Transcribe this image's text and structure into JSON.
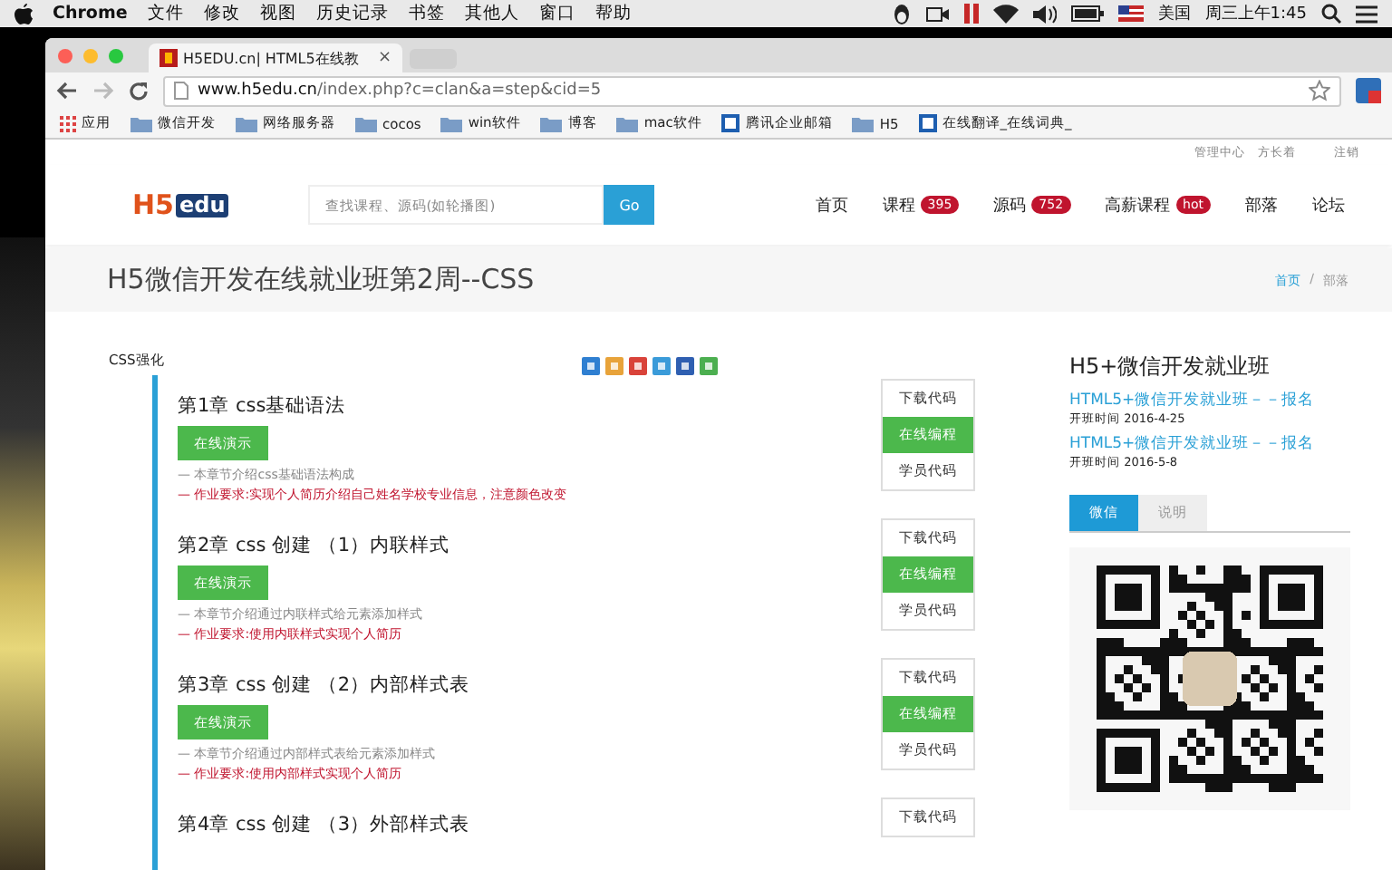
{
  "menu_bar": {
    "app": "Chrome",
    "menus": [
      "文件",
      "修改",
      "视图",
      "历史记录",
      "书签",
      "其他人",
      "窗口",
      "帮助"
    ],
    "input_source": "美国",
    "clock": "周三上午1:45"
  },
  "browser": {
    "tab": {
      "title": "H5EDU.cn| HTML5在线教",
      "close": "×"
    },
    "url": {
      "host": "www.h5edu.cn",
      "path": "/index.php?c=clan&a=step&cid=5"
    },
    "bookmarks": [
      {
        "label": "应用",
        "kind": "apps"
      },
      {
        "label": "微信开发",
        "kind": "folder"
      },
      {
        "label": "网络服务器",
        "kind": "folder"
      },
      {
        "label": "cocos",
        "kind": "folder"
      },
      {
        "label": "win软件",
        "kind": "folder"
      },
      {
        "label": "博客",
        "kind": "folder"
      },
      {
        "label": "mac软件",
        "kind": "folder"
      },
      {
        "label": "腾讯企业邮箱",
        "kind": "page"
      },
      {
        "label": "H5",
        "kind": "folder"
      },
      {
        "label": "在线翻译_在线词典_",
        "kind": "page"
      }
    ]
  },
  "page": {
    "top_links": [
      "管理中心",
      "方长着",
      "注销"
    ],
    "logo": {
      "h5": "H5",
      "edu": "edu"
    },
    "search": {
      "placeholder": "查找课程、源码(如轮播图)",
      "button": "Go"
    },
    "nav": [
      {
        "label": "首页"
      },
      {
        "label": "课程",
        "badge": "395"
      },
      {
        "label": "源码",
        "badge": "752"
      },
      {
        "label": "高薪课程",
        "badge": "hot"
      },
      {
        "label": "部落"
      },
      {
        "label": "论坛"
      }
    ],
    "title": "H5微信开发在线就业班第2周--CSS",
    "breadcrumb": {
      "items": [
        "首页",
        "部落"
      ],
      "separator": "/"
    },
    "section_label": "CSS强化",
    "chapters": [
      {
        "title": "第1章 css基础语法",
        "demo": "在线演示",
        "desc": "— 本章节介绍css基础语法构成",
        "task": "— 作业要求:实现个人简历介绍自己姓名学校专业信息，注意颜色改变",
        "buttons": [
          "下载代码",
          "在线编程",
          "学员代码"
        ]
      },
      {
        "title": "第2章 css 创建 （1）内联样式",
        "demo": "在线演示",
        "desc": "— 本章节介绍通过内联样式给元素添加样式",
        "task": "— 作业要求:使用内联样式实现个人简历",
        "buttons": [
          "下载代码",
          "在线编程",
          "学员代码"
        ]
      },
      {
        "title": "第3章 css 创建 （2）内部样式表",
        "demo": "在线演示",
        "desc": "— 本章节介绍通过内部样式表给元素添加样式",
        "task": "— 作业要求:使用内部样式实现个人简历",
        "buttons": [
          "下载代码",
          "在线编程",
          "学员代码"
        ]
      },
      {
        "title": "第4章 css 创建 （3）外部样式表",
        "buttons": [
          "下载代码"
        ]
      }
    ],
    "sidebar": {
      "heading": "H5+微信开发就业班",
      "classes": [
        {
          "link": "HTML5+微信开发就业班－－报名",
          "date": "开班时间 2016-4-25"
        },
        {
          "link": "HTML5+微信开发就业班－－报名",
          "date": "开班时间 2016-5-8"
        }
      ],
      "tabs": [
        {
          "label": "微信",
          "selected": true
        },
        {
          "label": "说明",
          "selected": false
        }
      ]
    }
  }
}
